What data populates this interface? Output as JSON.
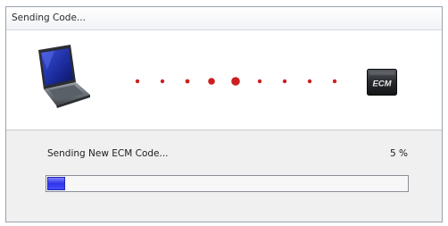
{
  "window": {
    "title": "Sending Code..."
  },
  "animation": {
    "source_icon": "laptop-icon",
    "target_icon": "ecm-chip-icon",
    "target_label": "ECM",
    "dot_color": "#cc1f1f"
  },
  "progress": {
    "label": "Sending New ECM Code...",
    "percent_text": "5 %",
    "fraction": 0.05,
    "fill_color": "#3b41f2"
  }
}
